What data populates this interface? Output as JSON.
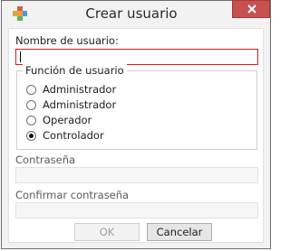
{
  "window": {
    "title": "Crear usuario"
  },
  "form": {
    "username": {
      "label": "Nombre de usuario:",
      "value": ""
    },
    "role_group": {
      "legend": "Función de usuario",
      "options": [
        {
          "label": "Administrador",
          "checked": false
        },
        {
          "label": "Administrador",
          "checked": false
        },
        {
          "label": "Operador",
          "checked": false
        },
        {
          "label": "Controlador",
          "checked": true
        }
      ]
    },
    "password": {
      "label": "Contraseña",
      "value": ""
    },
    "confirm_password": {
      "label": "Confirmar contraseña",
      "value": ""
    }
  },
  "buttons": {
    "ok_label": "OK",
    "cancel_label": "Cancelar"
  },
  "colors": {
    "focus_border": "#d41e1e",
    "close_button": "#c75050"
  },
  "icons": {
    "app": "app-icon",
    "close": "close-icon"
  }
}
